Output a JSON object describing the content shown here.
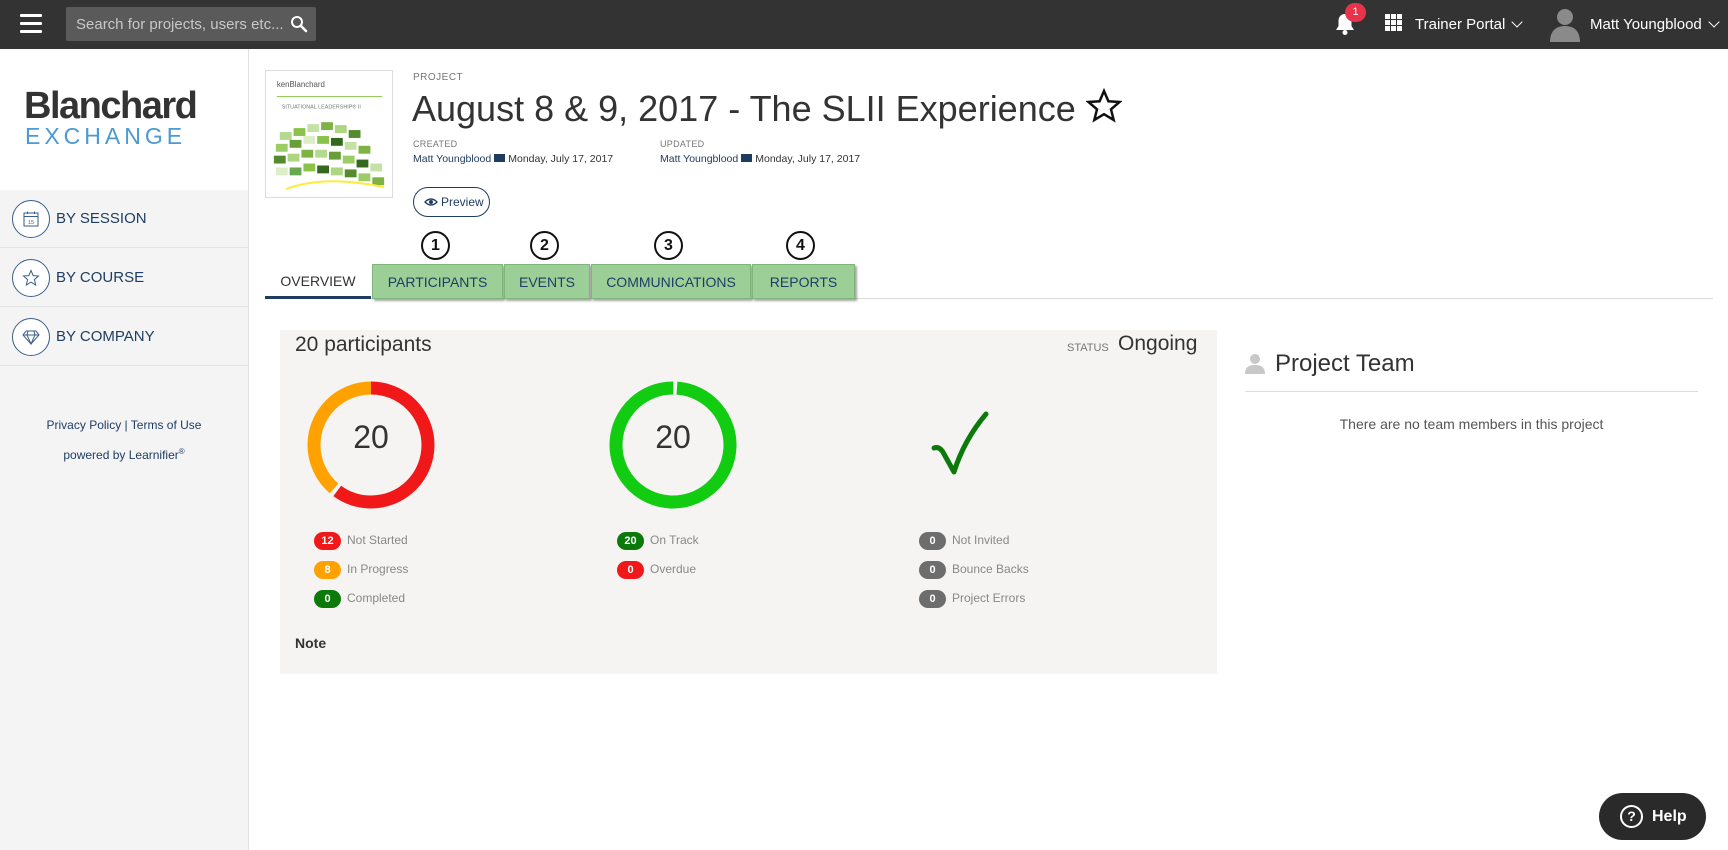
{
  "topbar": {
    "search_placeholder": "Search for projects, users etc...",
    "notification_count": "1",
    "portal_label": "Trainer Portal",
    "user_name": "Matt Youngblood"
  },
  "sidebar": {
    "logo_top": "Blanchard",
    "logo_bottom": "EXCHANGE",
    "items": [
      {
        "label": "BY SESSION",
        "icon": "calendar-icon"
      },
      {
        "label": "BY COURSE",
        "icon": "star-icon"
      },
      {
        "label": "BY COMPANY",
        "icon": "diamond-icon"
      }
    ],
    "privacy_label": "Privacy Policy",
    "separator": "|",
    "terms_label": "Terms of Use",
    "powered_by": "powered by Learnifier",
    "powered_mark": "®"
  },
  "project": {
    "section_label": "PROJECT",
    "title": "August 8 & 9, 2017 - The SLII Experience",
    "created_label": "CREATED",
    "created_by": "Matt Youngblood",
    "created_date": "Monday, July 17, 2017",
    "updated_label": "UPDATED",
    "updated_by": "Matt Youngblood",
    "updated_date": "Monday, July 17, 2017",
    "preview_label": "Preview",
    "thumbnail_brand": "kenBlanchard",
    "thumbnail_caption": "SITUATIONAL LEADERSHIP® II"
  },
  "tabs": [
    {
      "label": "OVERVIEW",
      "number": ""
    },
    {
      "label": "PARTICIPANTS",
      "number": "1"
    },
    {
      "label": "EVENTS",
      "number": "2"
    },
    {
      "label": "COMMUNICATIONS",
      "number": "3"
    },
    {
      "label": "REPORTS",
      "number": "4"
    }
  ],
  "stats": {
    "participants_label": "20 participants",
    "status_label": "STATUS",
    "status_value": "Ongoing",
    "progress": {
      "total": "20",
      "not_started": {
        "count": "12",
        "label": "Not Started",
        "color": "#f01818"
      },
      "in_progress": {
        "count": "8",
        "label": "In Progress",
        "color": "#ffa200"
      },
      "completed": {
        "count": "0",
        "label": "Completed",
        "color": "#0b7a0b"
      }
    },
    "schedule": {
      "total": "20",
      "on_track": {
        "count": "20",
        "label": "On Track",
        "color": "#0b7a0b"
      },
      "overdue": {
        "count": "0",
        "label": "Overdue",
        "color": "#f01818"
      }
    },
    "communication": {
      "icon": "checkmark-icon",
      "not_invited": {
        "count": "0",
        "label": "Not Invited"
      },
      "bounce_backs": {
        "count": "0",
        "label": "Bounce Backs"
      },
      "project_errors": {
        "count": "0",
        "label": "Project Errors"
      }
    },
    "note_label": "Note"
  },
  "team": {
    "title": "Project Team",
    "empty_message": "There are no team members in this project"
  },
  "help": {
    "label": "Help"
  },
  "colors": {
    "topbar": "#333333",
    "brand_blue": "#1f3d63",
    "tab_highlight": "#9ccf98",
    "ring_green": "#11cc11",
    "badge_grey": "#6d6d6d"
  }
}
